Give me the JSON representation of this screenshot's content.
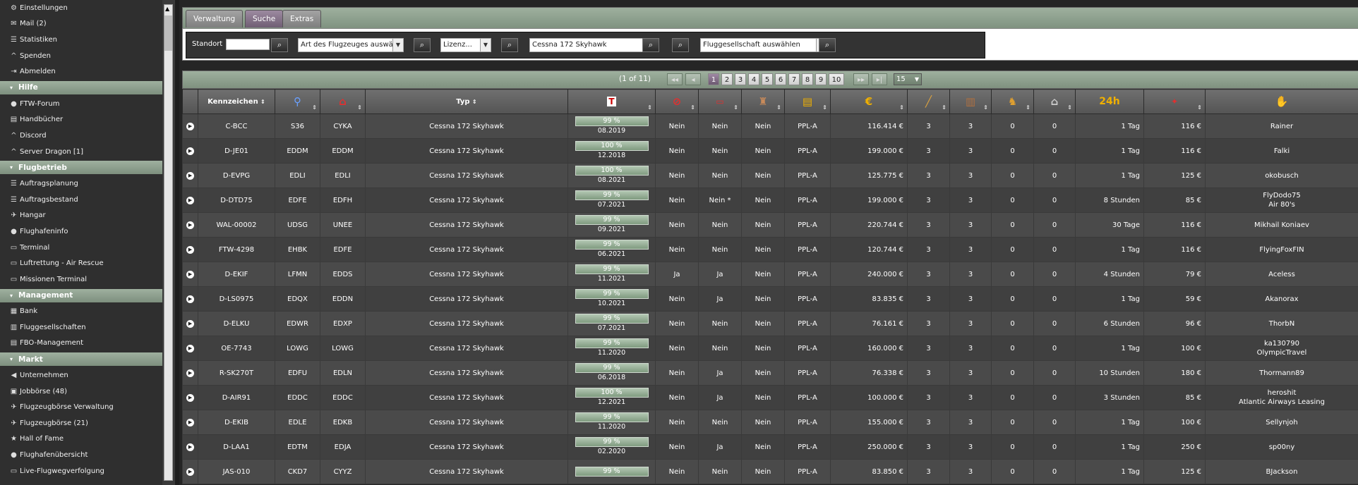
{
  "sidebar": {
    "sections": [
      {
        "header": null,
        "items": [
          {
            "icon": "gears-icon",
            "glyph": "⚙",
            "label": "Einstellungen"
          },
          {
            "icon": "mail-icon",
            "glyph": "✉",
            "label": "Mail (2)"
          },
          {
            "icon": "list-icon",
            "glyph": "☰",
            "label": "Statistiken"
          },
          {
            "icon": "caret-icon",
            "glyph": "^",
            "label": "Spenden"
          },
          {
            "icon": "logout-icon",
            "glyph": "⇥",
            "label": "Abmelden"
          }
        ]
      },
      {
        "header": "Hilfe",
        "items": [
          {
            "icon": "info-icon",
            "glyph": "●",
            "label": "FTW-Forum"
          },
          {
            "icon": "book-icon",
            "glyph": "▤",
            "label": "Handbücher"
          },
          {
            "icon": "caret-icon",
            "glyph": "^",
            "label": "Discord"
          },
          {
            "icon": "caret-icon",
            "glyph": "^",
            "label": "Server Dragon [1]"
          }
        ]
      },
      {
        "header": "Flugbetrieb",
        "items": [
          {
            "icon": "list-icon",
            "glyph": "☰",
            "label": "Auftragsplanung"
          },
          {
            "icon": "list-icon",
            "glyph": "☰",
            "label": "Auftragsbestand"
          },
          {
            "icon": "plane-icon",
            "glyph": "✈",
            "label": "Hangar"
          },
          {
            "icon": "globe-icon",
            "glyph": "●",
            "label": "Flughafeninfo"
          },
          {
            "icon": "laptop-icon",
            "glyph": "▭",
            "label": "Terminal"
          },
          {
            "icon": "laptop-icon",
            "glyph": "▭",
            "label": "Luftrettung - Air Rescue"
          },
          {
            "icon": "laptop-icon",
            "glyph": "▭",
            "label": "Missionen Terminal"
          }
        ]
      },
      {
        "header": "Management",
        "items": [
          {
            "icon": "bank-icon",
            "glyph": "▦",
            "label": "Bank"
          },
          {
            "icon": "building-icon",
            "glyph": "▥",
            "label": "Fluggesellschaften"
          },
          {
            "icon": "document-icon",
            "glyph": "▤",
            "label": "FBO-Management"
          }
        ]
      },
      {
        "header": "Markt",
        "items": [
          {
            "icon": "megaphone-icon",
            "glyph": "◀",
            "label": "Unternehmen"
          },
          {
            "icon": "briefcase-icon",
            "glyph": "▣",
            "label": "Jobbörse (48)"
          },
          {
            "icon": "plane-icon",
            "glyph": "✈",
            "label": "Flugzeugbörse Verwaltung"
          },
          {
            "icon": "plane-icon",
            "glyph": "✈",
            "label": "Flugzeugbörse (21)"
          },
          {
            "icon": "star-icon",
            "glyph": "★",
            "label": "Hall of Fame"
          },
          {
            "icon": "globe-icon",
            "glyph": "●",
            "label": "Flughafenübersicht"
          },
          {
            "icon": "laptop-icon",
            "glyph": "▭",
            "label": "Live-Flugwegverfolgung"
          }
        ]
      }
    ]
  },
  "tabs": [
    "Verwaltung",
    "Suche",
    "Extras"
  ],
  "active_tab": "Suche",
  "filters": {
    "standort_label": "Standort",
    "standort_value": "",
    "aircraft_kind": "Art des Flugzeuges auswählen",
    "license": "Lizenz...",
    "type": "Cessna 172 Skyhawk",
    "airline": "Fluggesellschaft auswählen"
  },
  "pager": {
    "info": "(1 of 11)",
    "first": "◂◂",
    "prev": "◂",
    "pages": [
      "1",
      "2",
      "3",
      "4",
      "5",
      "6",
      "7",
      "8",
      "9",
      "10"
    ],
    "current": "1",
    "next": "▸▸",
    "last": "▸|",
    "rows_per_page": "15"
  },
  "table": {
    "headers": {
      "kennzeichen": "Kennzeichen",
      "typ": "Typ",
      "h24": "24h"
    },
    "rows": [
      [
        "C-BCC",
        "S36",
        "CYKA",
        "Cessna 172 Skyhawk",
        "99 %",
        "08.2019",
        "Nein",
        "Nein",
        "Nein",
        "PPL-A",
        "116.414 €",
        "3",
        "3",
        "0",
        "0",
        "1 Tag",
        "116 €",
        "Rainer"
      ],
      [
        "D-JE01",
        "EDDM",
        "EDDM",
        "Cessna 172 Skyhawk",
        "100 %",
        "12.2018",
        "Nein",
        "Nein",
        "Nein",
        "PPL-A",
        "199.000 €",
        "3",
        "3",
        "0",
        "0",
        "1 Tag",
        "116 €",
        "Falki"
      ],
      [
        "D-EVPG",
        "EDLI",
        "EDLI",
        "Cessna 172 Skyhawk",
        "100 %",
        "08.2021",
        "Nein",
        "Nein",
        "Nein",
        "PPL-A",
        "125.775 €",
        "3",
        "3",
        "0",
        "0",
        "1 Tag",
        "125 €",
        "okobusch"
      ],
      [
        "D-DTD75",
        "EDFE",
        "EDFH",
        "Cessna 172 Skyhawk",
        "99 %",
        "07.2021",
        "Nein",
        "Nein *",
        "Nein",
        "PPL-A",
        "199.000 €",
        "3",
        "3",
        "0",
        "0",
        "8 Stunden",
        "85 €",
        "FlyDodo75\nAir 80's"
      ],
      [
        "WAL-00002",
        "UDSG",
        "UNEE",
        "Cessna 172 Skyhawk",
        "99 %",
        "09.2021",
        "Nein",
        "Nein",
        "Nein",
        "PPL-A",
        "220.744 €",
        "3",
        "3",
        "0",
        "0",
        "30 Tage",
        "116 €",
        "Mikhail Koniaev"
      ],
      [
        "FTW-4298",
        "EHBK",
        "EDFE",
        "Cessna 172 Skyhawk",
        "99 %",
        "06.2021",
        "Nein",
        "Nein",
        "Nein",
        "PPL-A",
        "120.744 €",
        "3",
        "3",
        "0",
        "0",
        "1 Tag",
        "116 €",
        "FlyingFoxFIN"
      ],
      [
        "D-EKIF",
        "LFMN",
        "EDDS",
        "Cessna 172 Skyhawk",
        "99 %",
        "11.2021",
        "Ja",
        "Ja",
        "Nein",
        "PPL-A",
        "240.000 €",
        "3",
        "3",
        "0",
        "0",
        "4 Stunden",
        "79 €",
        "Aceless"
      ],
      [
        "D-LS0975",
        "EDQX",
        "EDDN",
        "Cessna 172 Skyhawk",
        "99 %",
        "10.2021",
        "Nein",
        "Ja",
        "Nein",
        "PPL-A",
        "83.835 €",
        "3",
        "3",
        "0",
        "0",
        "1 Tag",
        "59 €",
        "Akanorax"
      ],
      [
        "D-ELKU",
        "EDWR",
        "EDXP",
        "Cessna 172 Skyhawk",
        "99 %",
        "07.2021",
        "Nein",
        "Nein",
        "Nein",
        "PPL-A",
        "76.161 €",
        "3",
        "3",
        "0",
        "0",
        "6 Stunden",
        "96 €",
        "ThorbN"
      ],
      [
        "OE-7743",
        "LOWG",
        "LOWG",
        "Cessna 172 Skyhawk",
        "99 %",
        "11.2020",
        "Nein",
        "Nein",
        "Nein",
        "PPL-A",
        "160.000 €",
        "3",
        "3",
        "0",
        "0",
        "1 Tag",
        "100 €",
        "ka130790\nOlympicTravel"
      ],
      [
        "R-SK270T",
        "EDFU",
        "EDLN",
        "Cessna 172 Skyhawk",
        "99 %",
        "06.2018",
        "Nein",
        "Ja",
        "Nein",
        "PPL-A",
        "76.338 €",
        "3",
        "3",
        "0",
        "0",
        "10 Stunden",
        "180 €",
        "Thormann89"
      ],
      [
        "D-AIR91",
        "EDDC",
        "EDDC",
        "Cessna 172 Skyhawk",
        "100 %",
        "12.2021",
        "Nein",
        "Ja",
        "Nein",
        "PPL-A",
        "100.000 €",
        "3",
        "3",
        "0",
        "0",
        "3 Stunden",
        "85 €",
        "heroshit\nAtlantic Airways Leasing"
      ],
      [
        "D-EKIB",
        "EDLE",
        "EDKB",
        "Cessna 172 Skyhawk",
        "99 %",
        "11.2020",
        "Nein",
        "Nein",
        "Nein",
        "PPL-A",
        "155.000 €",
        "3",
        "3",
        "0",
        "0",
        "1 Tag",
        "100 €",
        "Sellynjoh"
      ],
      [
        "D-LAA1",
        "EDTM",
        "EDJA",
        "Cessna 172 Skyhawk",
        "99 %",
        "02.2020",
        "Nein",
        "Ja",
        "Nein",
        "PPL-A",
        "250.000 €",
        "3",
        "3",
        "0",
        "0",
        "1 Tag",
        "250 €",
        "sp00ny"
      ],
      [
        "JAS-010",
        "CKD7",
        "CYYZ",
        "Cessna 172 Skyhawk",
        "99 %",
        "",
        "Nein",
        "Nein",
        "Nein",
        "PPL-A",
        "83.850 €",
        "3",
        "3",
        "0",
        "0",
        "1 Tag",
        "125 €",
        "BJackson"
      ]
    ]
  },
  "colors": {
    "accent_green": "#8ea08e",
    "active_purple": "#7f6c84",
    "row_dark": "#404040",
    "row_light": "#4a4a4a"
  }
}
